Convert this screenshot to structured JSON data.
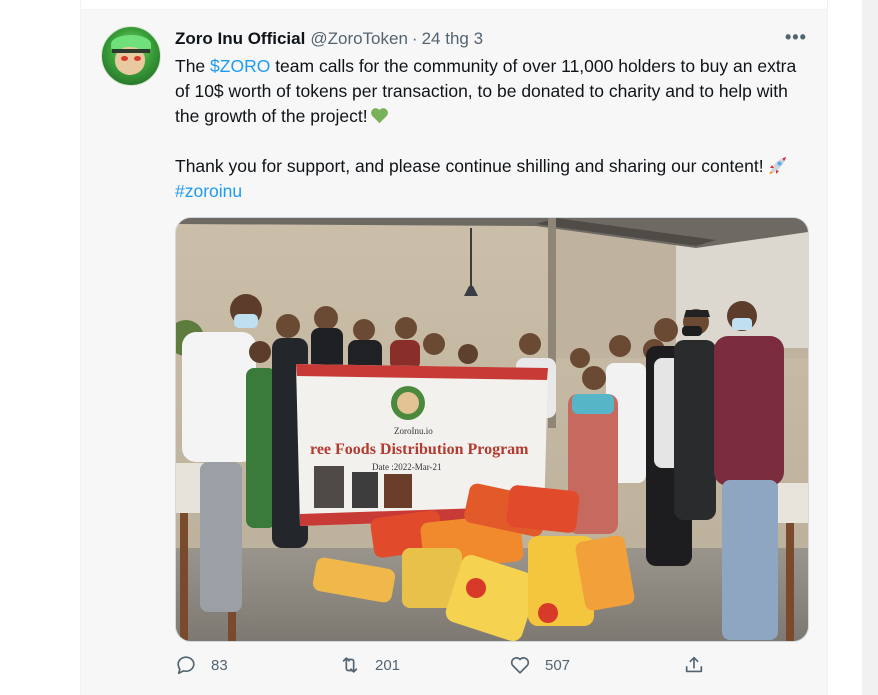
{
  "tweet": {
    "author_name": "Zoro Inu Official",
    "handle": "@ZoroToken",
    "separator": "·",
    "date": "24 thg 3",
    "more_label": "•••",
    "paragraph1_prefix": "The ",
    "cashtag": "$ZORO",
    "paragraph1_body": " team calls for the community of over 11,000 holders to buy an extra of 10$ worth of tokens per transaction, to be donated to charity and to help with the growth of the project!",
    "paragraph2_body": "Thank you for support, and please continue shilling and sharing our content!",
    "hashtag": "#zoroinu"
  },
  "photo": {
    "banner_brand": "ZoroInu.io",
    "banner_title": "ree Foods Distribution Program",
    "banner_date": "Date :2022-Mar-21"
  },
  "actions": {
    "reply_count": "83",
    "retweet_count": "201",
    "like_count": "507"
  },
  "icons": {
    "reply": "reply-icon",
    "retweet": "retweet-icon",
    "like": "heart-icon",
    "share": "share-icon"
  },
  "colors": {
    "link": "#1d9bf0",
    "text": "#0f1419",
    "muted": "#536471"
  }
}
